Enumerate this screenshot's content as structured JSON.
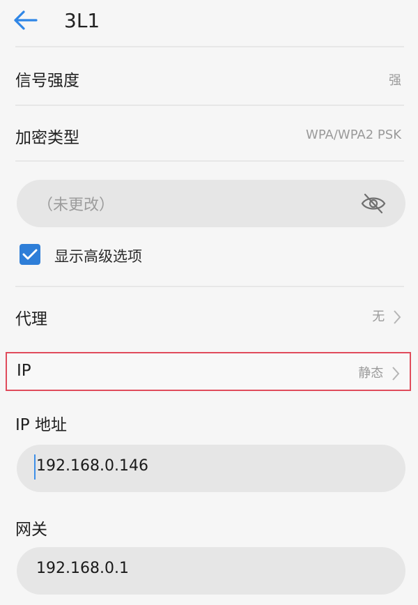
{
  "header": {
    "title": "3L1"
  },
  "details": {
    "signal_strength_label": "信号强度",
    "signal_strength_value": "强",
    "encryption_label": "加密类型",
    "encryption_value": "WPA/WPA2 PSK"
  },
  "password": {
    "placeholder": "（未更改）"
  },
  "advanced": {
    "label": "显示高级选项",
    "checked": true
  },
  "proxy": {
    "label": "代理",
    "value": "无"
  },
  "ip": {
    "label": "IP",
    "value": "静态"
  },
  "ip_address": {
    "label": "IP 地址",
    "value": "192.168.0.146"
  },
  "gateway": {
    "label": "网关",
    "value": "192.168.0.1"
  },
  "colors": {
    "accent": "#2e7ed8",
    "highlight_border": "#e04b5b"
  },
  "icons": {
    "back": "arrow-left-icon",
    "visibility": "eye-off-icon",
    "chevron": "chevron-right-icon"
  }
}
